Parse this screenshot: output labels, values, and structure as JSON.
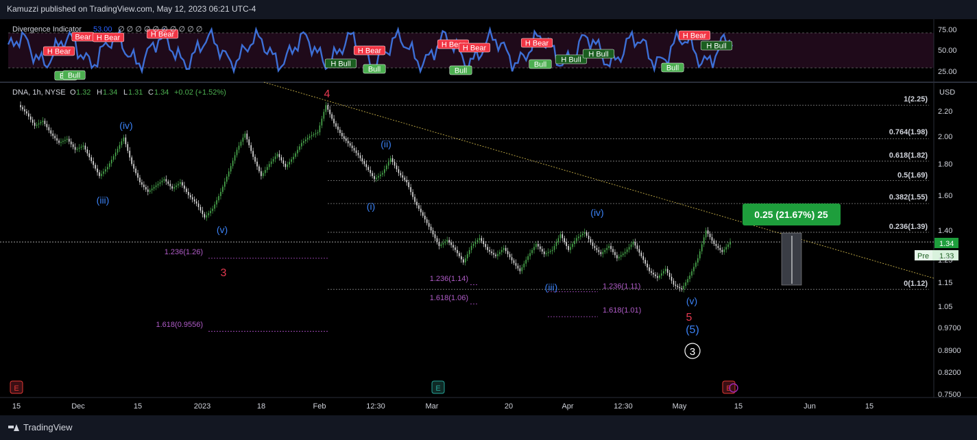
{
  "header": {
    "publish_line": "Kamuzzi published on TradingView.com, May 12, 2023 06:21 UTC-4"
  },
  "footer": {
    "brand": "TradingView"
  },
  "indicator": {
    "name": "Divergence Indicator",
    "value": "53.00",
    "extra": "∅ ∅ ∅ ∅ ∅ ∅ ∅ ∅ ∅ ∅",
    "axis_ticks": [
      "75.00",
      "50.00",
      "25.00"
    ],
    "labels": [
      {
        "text": "Bear",
        "kind": "bear"
      },
      {
        "text": "H Bear",
        "kind": "bear"
      },
      {
        "text": "H Bear",
        "kind": "bear"
      },
      {
        "text": "H Bear",
        "kind": "bear"
      },
      {
        "text": "H Bear",
        "kind": "bear"
      },
      {
        "text": "H Bear",
        "kind": "bear"
      },
      {
        "text": "H Bear",
        "kind": "bear"
      },
      {
        "text": "H Bear",
        "kind": "bear"
      },
      {
        "text": "H Bear",
        "kind": "bear"
      },
      {
        "text": "Bull",
        "kind": "bull"
      },
      {
        "text": "Bull",
        "kind": "bull"
      },
      {
        "text": "H Bull",
        "kind": "hbull"
      },
      {
        "text": "Bull",
        "kind": "bull"
      },
      {
        "text": "Bull",
        "kind": "bull"
      },
      {
        "text": "Bull",
        "kind": "bull"
      },
      {
        "text": "H Bull",
        "kind": "hbull"
      },
      {
        "text": "H Bull",
        "kind": "hbull"
      },
      {
        "text": "Bull",
        "kind": "bull"
      },
      {
        "text": "H Bull",
        "kind": "hbull"
      }
    ]
  },
  "symbol": {
    "ticker": "DNA, 1h, NYSE",
    "open_label": "O",
    "open": "1.32",
    "high_label": "H",
    "high": "1.34",
    "low_label": "L",
    "low": "1.31",
    "close_label": "C",
    "close": "1.34",
    "change": "+0.02 (+1.52%)",
    "currency": "USD"
  },
  "price_badges": {
    "last": "1.34",
    "pre_label": "Pre",
    "pre": "1.33"
  },
  "measure_box": {
    "text": "0.25 (21.67%) 25"
  },
  "fib_levels": [
    "1(2.25)",
    "0.764(1.98)",
    "0.618(1.82)",
    "0.5(1.69)",
    "0.382(1.55)",
    "0.236(1.39)",
    "0(1.12)"
  ],
  "ext_labels": [
    "1.236(1.26)",
    "1.618(0.9556)",
    "1.236(1.14)",
    "1.618(1.06)",
    "1.236(1.11)",
    "1.618(1.01)"
  ],
  "wave_labels": [
    "(iv)",
    "(iii)",
    "(v)",
    "3",
    "4",
    "(ii)",
    "(i)",
    "(iii)",
    "(iv)",
    "(v)",
    "5",
    "(5)",
    "3"
  ],
  "y_ticks": [
    "2.20",
    "2.00",
    "1.80",
    "1.60",
    "1.40",
    "1.25",
    "1.15",
    "1.05",
    "0.9700",
    "0.8900",
    "0.8200",
    "0.7500"
  ],
  "x_ticks": [
    "15",
    "Dec",
    "15",
    "2023",
    "18",
    "Feb",
    "12:30",
    "Mar",
    "20",
    "Apr",
    "12:30",
    "May",
    "15",
    "Jun",
    "15"
  ],
  "event_icons": [
    "E",
    "E",
    "E"
  ],
  "chart_data": {
    "type": "line",
    "title": "DNA, 1h, NYSE",
    "ylabel": "USD",
    "ylim": [
      0.75,
      2.25
    ],
    "log_scale": true,
    "series": [
      {
        "values": [
          2.25,
          2.18,
          2.08,
          2.12,
          2.02,
          1.95,
          1.98,
          1.9,
          1.93,
          1.82,
          1.72,
          1.78,
          1.88,
          1.99,
          1.8,
          1.68,
          1.62,
          1.66,
          1.7,
          1.64,
          1.68,
          1.6,
          1.55,
          1.47,
          1.52,
          1.62,
          1.75,
          1.9,
          2.02,
          1.85,
          1.72,
          1.8,
          1.87,
          1.78,
          1.85,
          1.95,
          2.0,
          2.03,
          2.25,
          2.1,
          2.0,
          1.93,
          1.86,
          1.78,
          1.7,
          1.74,
          1.84,
          1.74,
          1.68,
          1.56,
          1.48,
          1.4,
          1.32,
          1.35,
          1.3,
          1.24,
          1.32,
          1.36,
          1.3,
          1.27,
          1.31,
          1.25,
          1.2,
          1.27,
          1.33,
          1.28,
          1.3,
          1.38,
          1.3,
          1.36,
          1.39,
          1.32,
          1.28,
          1.32,
          1.26,
          1.29,
          1.34,
          1.27,
          1.2,
          1.17,
          1.21,
          1.14,
          1.12,
          1.18,
          1.26,
          1.4,
          1.33,
          1.29,
          1.34
        ]
      }
    ]
  }
}
